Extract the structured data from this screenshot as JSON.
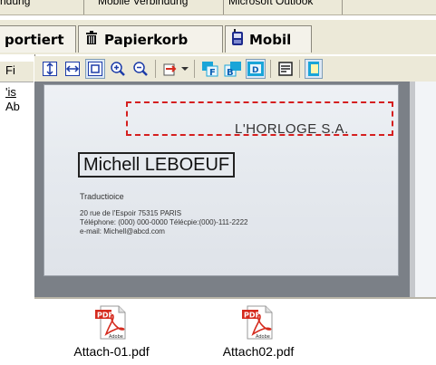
{
  "menubar": {
    "items": [
      "ndung",
      "Mobile Verbindung",
      "Microsoft Outlook"
    ]
  },
  "tabs": [
    {
      "label": "portiert",
      "icon": "none"
    },
    {
      "label": "Papierkorb",
      "icon": "trash-icon"
    },
    {
      "label": "Mobil",
      "icon": "mobile-icon"
    }
  ],
  "left_pane": {
    "labels": [
      "Fi",
      "'is",
      "Ab"
    ]
  },
  "toolbar": {
    "buttons": [
      "fit-height-icon",
      "fit-width-icon",
      "fit-page-icon",
      "zoom-in-icon",
      "zoom-out-icon",
      "export-icon",
      "dropdown-arrow-icon",
      "front-side-icon",
      "back-side-icon",
      "dual-side-icon",
      "scan-icon",
      "partial-icon"
    ]
  },
  "card": {
    "company": "L'HORLOGE S.A.",
    "name": "Michell LEBOEUF",
    "role": "Traductioice",
    "address_line": "20 rue de l'Espoir 75315 PARIS",
    "phone_line": "Téléphone: (000) 000-0000    Télécpie:(000)-111-2222",
    "email_line": "e-mail: Michell@abcd.com"
  },
  "attachments": [
    {
      "filename": "Attach-01.pdf",
      "badge": "PDF",
      "brand": "Adobe"
    },
    {
      "filename": "Attach02.pdf",
      "badge": "PDF",
      "brand": "Adobe"
    }
  ],
  "colors": {
    "highlight": "#d51f1f",
    "viewer_bg": "#7b8087",
    "chrome": "#ece9d8",
    "pdf_red": "#d52b1e"
  }
}
